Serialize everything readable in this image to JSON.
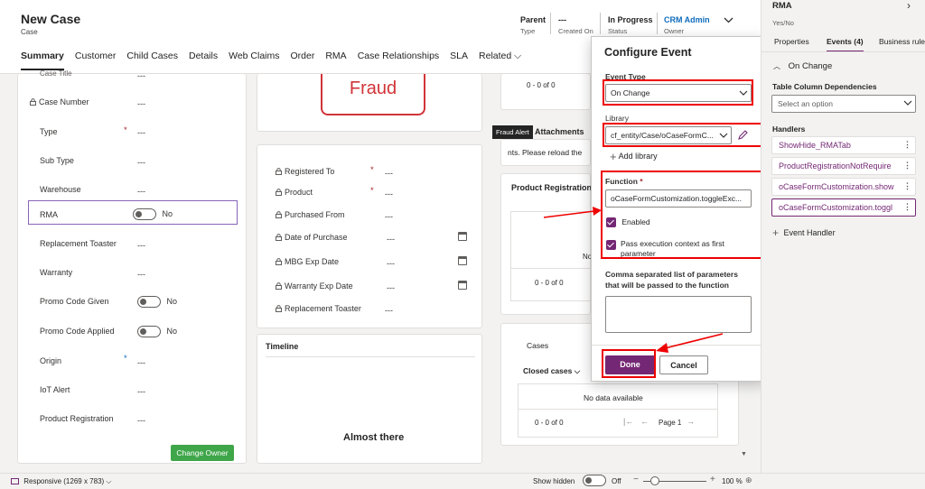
{
  "header": {
    "title": "New Case",
    "subtitle": "Case",
    "fields": [
      {
        "value": "Parent",
        "label": "Type"
      },
      {
        "value": "---",
        "label": "Created On"
      },
      {
        "value": "In Progress",
        "label": "Status"
      },
      {
        "value": "CRM Admin",
        "label": "Owner"
      }
    ]
  },
  "tabs": [
    "Summary",
    "Customer",
    "Child Cases",
    "Details",
    "Web Claims",
    "Order",
    "RMA",
    "Case Relationships",
    "SLA",
    "Related"
  ],
  "left_form": {
    "truncated_top": "Case Title",
    "rows": [
      {
        "label": "Case Number",
        "value": "---"
      },
      {
        "label": "Type",
        "value": "---"
      },
      {
        "label": "Sub Type",
        "value": "---"
      },
      {
        "label": "Warehouse",
        "value": "---"
      },
      {
        "label": "RMA",
        "value": "No"
      },
      {
        "label": "Replacement Toaster",
        "value": "---"
      },
      {
        "label": "Warranty",
        "value": "---"
      },
      {
        "label": "Promo Code Given",
        "value": "No"
      },
      {
        "label": "Promo Code Applied",
        "value": "No"
      },
      {
        "label": "Origin",
        "value": "---"
      },
      {
        "label": "IoT Alert",
        "value": "---"
      },
      {
        "label": "Product Registration",
        "value": "---"
      }
    ],
    "change_owner": "Change Owner"
  },
  "middle": {
    "fraud": "Fraud",
    "rows": [
      {
        "label": "Registered To",
        "value": "---"
      },
      {
        "label": "Product",
        "value": "---"
      },
      {
        "label": "Purchased From",
        "value": "---"
      },
      {
        "label": "Date of Purchase",
        "value": "---"
      },
      {
        "label": "MBG Exp Date",
        "value": "---"
      },
      {
        "label": "Warranty Exp Date",
        "value": "---"
      },
      {
        "label": "Replacement Toaster",
        "value": "---"
      }
    ],
    "timeline": "Timeline",
    "almost": "Almost there"
  },
  "right_col": {
    "pager_top": "0 - 0 of 0",
    "tooltip": "Fraud Alert",
    "attachments": "Attachments",
    "reload": "nts.  Please reload the",
    "product_reg": "Product Registrations",
    "no_short": "No",
    "pager_mid": "0 - 0 of 0",
    "cases": "Cases",
    "closed": "Closed cases",
    "nodata": "No data available",
    "pager_bot": "0 - 0 of 0",
    "page": "Page 1"
  },
  "dialog": {
    "title": "Configure Event",
    "event_type_label": "Event Type",
    "event_type_value": "On Change",
    "library_label": "Library",
    "library_value": "cf_entity/Case/oCaseFormC...",
    "add_library": "Add library",
    "function_label": "Function",
    "function_value": "oCaseFormCustomization.toggleExc...",
    "enabled": "Enabled",
    "pass_context": "Pass execution context as first parameter",
    "params_label": "Comma separated list of parameters that will be passed to the function",
    "done": "Done",
    "cancel": "Cancel"
  },
  "right_panel": {
    "title": "RMA",
    "subtitle": "Yes/No",
    "tabs": [
      "Properties",
      "Events (4)",
      "Business rule"
    ],
    "section": "On Change",
    "deps_label": "Table Column Dependencies",
    "deps_placeholder": "Select an option",
    "handlers_label": "Handlers",
    "handlers": [
      "ShowHide_RMATab",
      "ProductRegistrationNotRequire",
      "oCaseFormCustomization.show",
      "oCaseFormCustomization.toggl"
    ],
    "add_handler": "Event Handler"
  },
  "footer": {
    "responsive": "Responsive (1269 x 783)",
    "show_hidden": "Show hidden",
    "off": "Off",
    "zoom": "100 %"
  },
  "colors": {
    "accent": "#742774",
    "highlight_red": "#e00000",
    "fraud_red": "#d13438",
    "button_green": "#3fa64a"
  }
}
